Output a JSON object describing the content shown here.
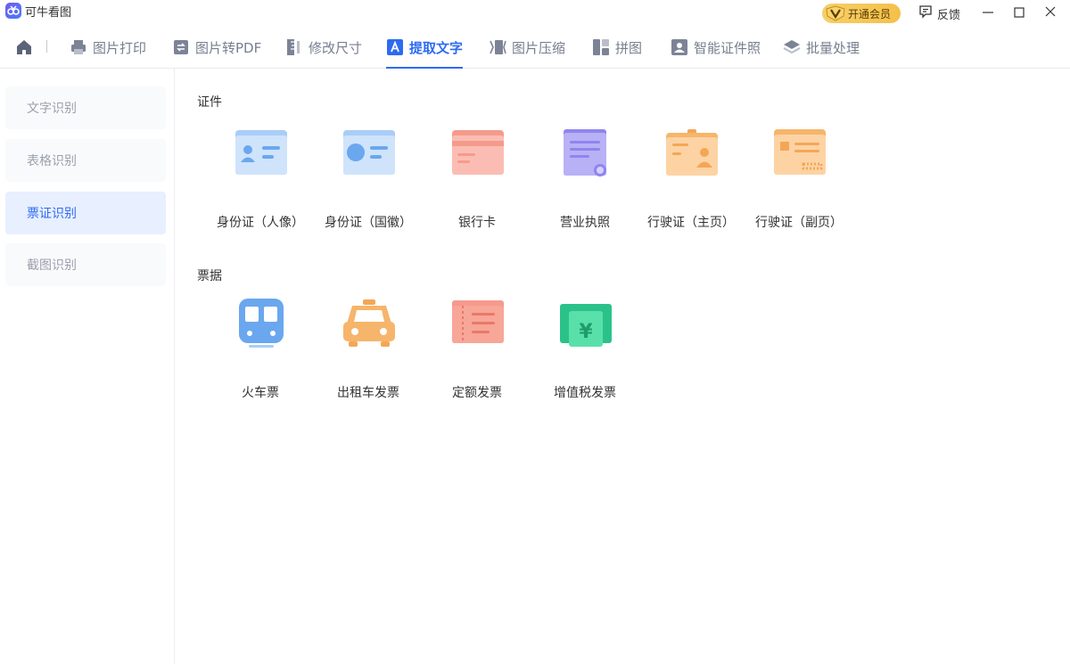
{
  "app": {
    "title": "可牛看图",
    "vip_label": "开通会员",
    "feedback_label": "反馈"
  },
  "toolbar": {
    "tabs": [
      {
        "label": "图片打印",
        "icon": "printer-icon"
      },
      {
        "label": "图片转PDF",
        "icon": "convert-pdf-icon"
      },
      {
        "label": "修改尺寸",
        "icon": "ruler-icon"
      },
      {
        "label": "提取文字",
        "icon": "text-extract-icon",
        "active": true
      },
      {
        "label": "图片压缩",
        "icon": "compress-icon"
      },
      {
        "label": "拼图",
        "icon": "collage-icon"
      },
      {
        "label": "智能证件照",
        "icon": "id-photo-icon"
      },
      {
        "label": "批量处理",
        "icon": "layers-icon"
      }
    ]
  },
  "sidebar": {
    "items": [
      {
        "label": "文字识别"
      },
      {
        "label": "表格识别"
      },
      {
        "label": "票证识别",
        "active": true
      },
      {
        "label": "截图识别"
      }
    ]
  },
  "main": {
    "sections": [
      {
        "title": "证件",
        "items": [
          {
            "label": "身份证（人像）",
            "icon": "id-card-portrait-icon"
          },
          {
            "label": "身份证（国徽）",
            "icon": "id-card-emblem-icon"
          },
          {
            "label": "银行卡",
            "icon": "bank-card-icon"
          },
          {
            "label": "营业执照",
            "icon": "business-license-icon"
          },
          {
            "label": "行驶证（主页）",
            "icon": "driving-license-main-icon"
          },
          {
            "label": "行驶证（副页）",
            "icon": "driving-license-sub-icon"
          }
        ]
      },
      {
        "title": "票据",
        "items": [
          {
            "label": "火车票",
            "icon": "train-ticket-icon"
          },
          {
            "label": "出租车发票",
            "icon": "taxi-invoice-icon"
          },
          {
            "label": "定额发票",
            "icon": "fixed-invoice-icon"
          },
          {
            "label": "增值税发票",
            "icon": "vat-invoice-icon"
          }
        ]
      }
    ],
    "currency_symbol": "¥"
  },
  "colors": {
    "accent": "#2d6bf0",
    "vip_gold": "#f4c04a"
  }
}
